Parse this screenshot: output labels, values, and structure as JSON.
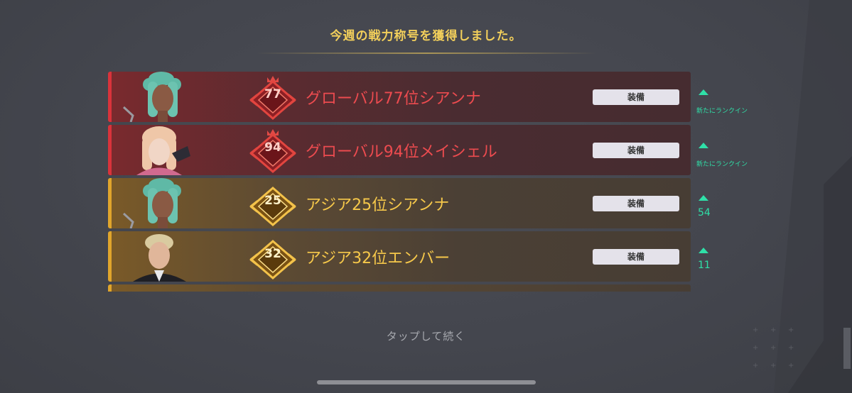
{
  "header": {
    "title": "今週の戦力称号を獲得しました。"
  },
  "rows": [
    {
      "variant": "red",
      "rank_number": "77",
      "title": "グローバル77位シアンナ",
      "equip_label": "装備",
      "change_type": "new",
      "change_text": "新たにランクイン",
      "character_icon": "sianna-portrait"
    },
    {
      "variant": "red",
      "rank_number": "94",
      "title": "グローバル94位メイシェル",
      "equip_label": "装備",
      "change_type": "new",
      "change_text": "新たにランクイン",
      "character_icon": "meishel-portrait"
    },
    {
      "variant": "gold",
      "rank_number": "25",
      "title": "アジア25位シアンナ",
      "equip_label": "装備",
      "change_type": "up",
      "change_text": "54",
      "character_icon": "sianna-portrait"
    },
    {
      "variant": "gold",
      "rank_number": "32",
      "title": "アジア32位エンバー",
      "equip_label": "装備",
      "change_type": "up",
      "change_text": "11",
      "character_icon": "ember-portrait"
    }
  ],
  "footer": {
    "tap_to_continue": "タップして続く"
  },
  "colors": {
    "red_text": "#ec4b4f",
    "gold_text": "#f6c84a",
    "header_gold": "#f2cf5b",
    "rank_up_green": "#2fe0a8"
  },
  "icons": {
    "rank_up": "triangle-up-icon",
    "badge": "rank-badge-icon"
  }
}
